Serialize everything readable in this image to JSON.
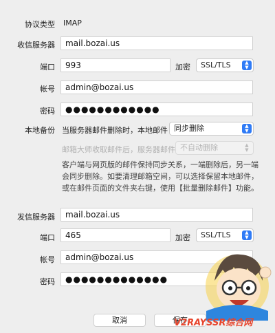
{
  "incoming": {
    "protocol_label": "协议类型",
    "protocol_value": "IMAP",
    "server_label": "收信服务器",
    "server_value": "mail.bozai.us",
    "port_label": "端口",
    "port_value": "993",
    "encryption_label": "加密",
    "encryption_value": "SSL/TLS",
    "account_label": "帐号",
    "account_value": "admin@bozai.us",
    "password_label": "密码",
    "password_value": "●●●●●●●●●●●●"
  },
  "backup": {
    "label": "本地备份",
    "rule1_text": "当服务器邮件删除时，本地邮件",
    "rule1_value": "同步删除",
    "rule2_text": "邮箱大师收取邮件后，服务器邮件",
    "rule2_value": "不自动删除",
    "note_line1": "客户端与网页版的邮件保持同步关系，一端删除后，另一端",
    "note_line2": "会同步删除。如要清理邮箱空间，可以选择保留本地邮件，",
    "note_line3": "或在邮件页面的文件夹右键，使用【批量删除邮件】功能。"
  },
  "outgoing": {
    "server_label": "发信服务器",
    "server_value": "mail.bozai.us",
    "port_label": "端口",
    "port_value": "465",
    "encryption_label": "加密",
    "encryption_value": "SSL/TLS",
    "account_label": "帐号",
    "account_value": "admin@bozai.us",
    "password_label": "密码",
    "password_value": "●●●●●●●●●●●●●"
  },
  "buttons": {
    "cancel": "取消",
    "save": "保存"
  },
  "watermark": "V2RAYSSR综合网",
  "colors": {
    "accent": "#2f7bf6",
    "watermark": "#e7442c"
  },
  "icons": {
    "stepper": "up-down-chevron-icon",
    "mascot": "mascot-avatar"
  }
}
